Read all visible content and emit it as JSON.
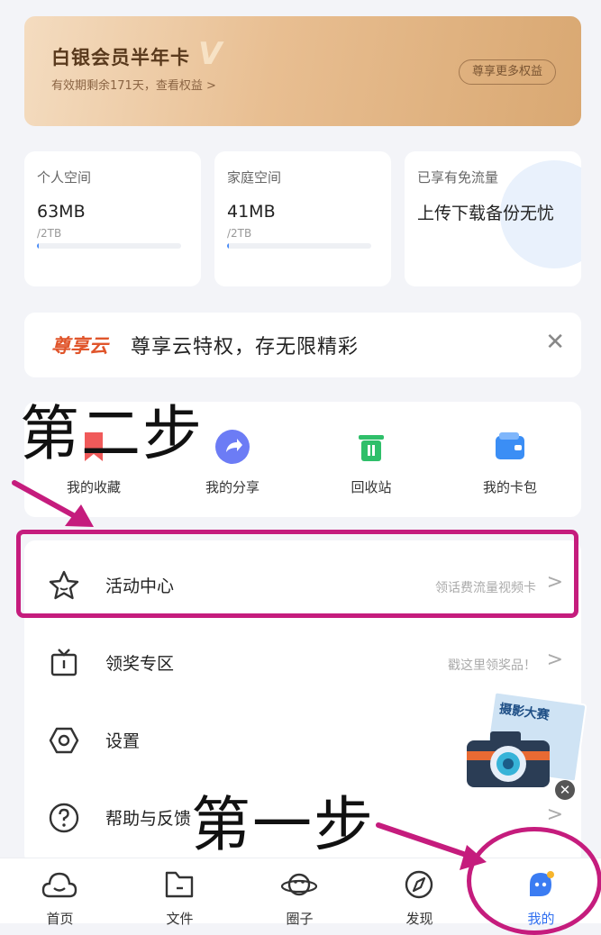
{
  "member": {
    "title": "白银会员半年卡",
    "badge": "V",
    "subtitle": "有效期剩余171天，查看权益 >",
    "button": "尊享更多权益"
  },
  "storage": [
    {
      "label": "个人空间",
      "value": "63MB",
      "total": "/2TB",
      "usage_fraction": 0.01
    },
    {
      "label": "家庭空间",
      "value": "41MB",
      "total": "/2TB",
      "usage_fraction": 0.01
    },
    {
      "label": "已享有免流量",
      "value": "上传下载备份无忧"
    }
  ],
  "promo": {
    "logo_text": "尊享云",
    "text": "尊享云特权，存无限精彩",
    "close": "✕"
  },
  "quick_actions": [
    {
      "label": "我的收藏",
      "icon": "bookmark-icon",
      "color": "#f05a5a"
    },
    {
      "label": "我的分享",
      "icon": "share-icon",
      "color": "#6c7cf5"
    },
    {
      "label": "回收站",
      "icon": "trash-icon",
      "color": "#2fbf6a"
    },
    {
      "label": "我的卡包",
      "icon": "wallet-icon",
      "color": "#3b8ef5"
    }
  ],
  "list": [
    {
      "label": "活动中心",
      "hint": "领话费流量视频卡",
      "icon": "star-icon"
    },
    {
      "label": "领奖专区",
      "hint": "戳这里领奖品！",
      "icon": "tv-gift-icon"
    },
    {
      "label": "设置",
      "hint": "",
      "icon": "settings-hexagon-icon"
    },
    {
      "label": "帮助与反馈",
      "hint": "",
      "icon": "help-icon"
    }
  ],
  "chevron": ">",
  "floating_ad": {
    "title": "摄影大赛",
    "close": "✕"
  },
  "annotations": {
    "step2": "第二步",
    "step1": "第一步",
    "color": "#c51c7d"
  },
  "bottom_nav": [
    {
      "label": "首页",
      "icon": "cloud-home-icon"
    },
    {
      "label": "文件",
      "icon": "folder-icon"
    },
    {
      "label": "圈子",
      "icon": "planet-icon"
    },
    {
      "label": "发现",
      "icon": "compass-icon"
    },
    {
      "label": "我的",
      "icon": "profile-icon",
      "active": true
    }
  ],
  "colors": {
    "accent": "#2f6ff0",
    "background": "#f3f4f8"
  }
}
